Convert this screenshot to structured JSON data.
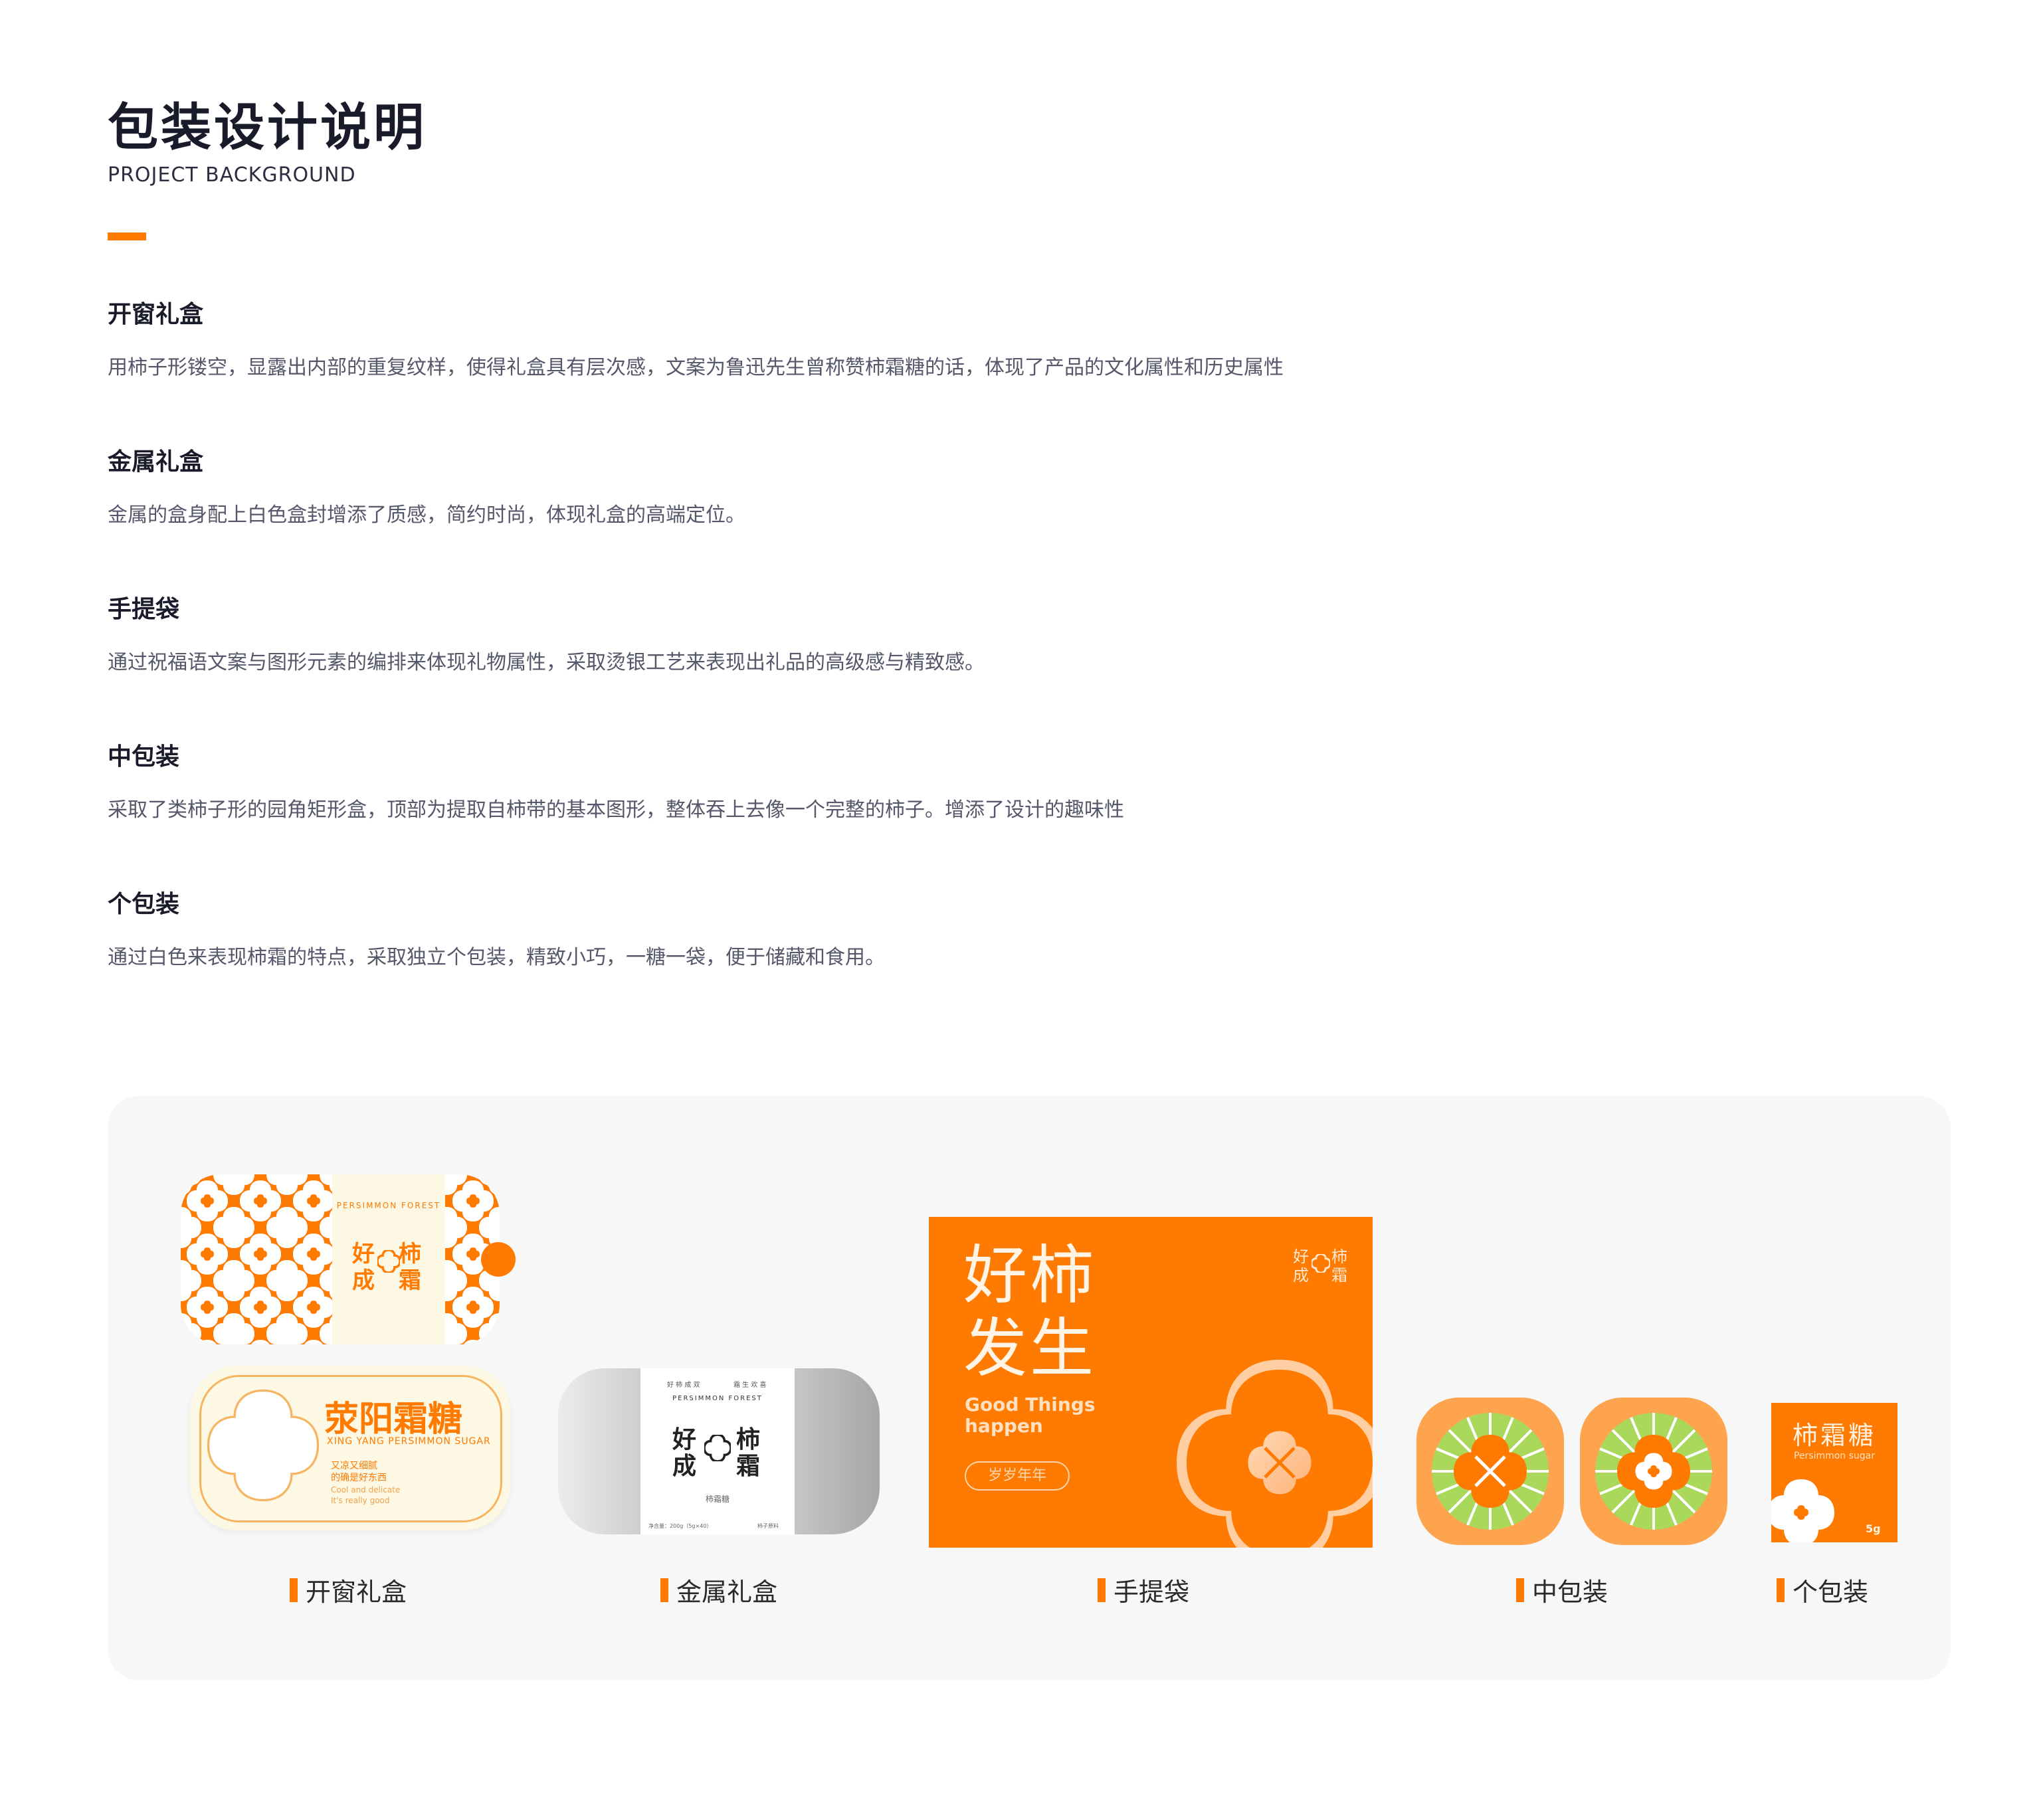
{
  "header": {
    "title": "包装设计说明",
    "subtitle": "PROJECT BACKGROUND"
  },
  "sections": [
    {
      "heading": "开窗礼盒",
      "text": "用柿子形镂空，显露出内部的重复纹样，使得礼盒具有层次感，文案为鲁迅先生曾称赞柿霜糖的话，体现了产品的文化属性和历史属性"
    },
    {
      "heading": "金属礼盒",
      "text": "金属的盒身配上白色盒封增添了质感，简约时尚，体现礼盒的高端定位。"
    },
    {
      "heading": "手提袋",
      "text": "通过祝福语文案与图形元素的编排来体现礼物属性，采取烫银工艺来表现出礼品的高级感与精致感。"
    },
    {
      "heading": "中包装",
      "text": "采取了类柿子形的园角矩形盒，顶部为提取自柿带的基本图形，整体吞上去像一个完整的柿子。增添了设计的趣味性"
    },
    {
      "heading": "个包装",
      "text": "通过白色来表现柿霜的特点，采取独立个包装，精致小巧，一糖一袋，便于储藏和食用。"
    }
  ],
  "products": {
    "window_box": {
      "caption": "开窗礼盒",
      "logo_top": "PERSIMMON FOREST",
      "logo_chars": [
        "好",
        "成",
        "柿",
        "霜"
      ],
      "brand_cn": "荥阳霜糖",
      "brand_en": "XING YANG PERSIMMON SUGAR",
      "quote_cn_1": "又凉又细腻",
      "quote_cn_2": "的确是好东西",
      "quote_en_1": "Cool and delicate",
      "quote_en_2": "It's really good"
    },
    "metal_box": {
      "caption": "金属礼盒",
      "top_left": "好 柿 成 双",
      "top_right": "霜 生 欢 喜",
      "logo_top": "PERSIMMON FOREST",
      "logo_chars": [
        "好",
        "成",
        "柿",
        "霜"
      ],
      "label": "柿霜糖",
      "foot_left": "净含量：200g（5g×40）",
      "foot_right": "柿子原料"
    },
    "bag": {
      "caption": "手提袋",
      "headline_1": "好柿",
      "headline_2": "发生",
      "en_1": "Good Things",
      "en_2": "happen",
      "pill": "岁岁年年",
      "logo_chars": [
        "好",
        "成",
        "柿",
        "霜"
      ]
    },
    "mid_pack": {
      "caption": "中包装"
    },
    "single_pack": {
      "caption": "个包装",
      "name_cn": "柿霜糖",
      "name_en": "Persimmon sugar",
      "weight": "5g"
    }
  },
  "colors": {
    "accent": "#ff7a00",
    "cream": "#fdf8e3",
    "panel": "#f7f7f7",
    "leaf": "#a9d85b"
  }
}
